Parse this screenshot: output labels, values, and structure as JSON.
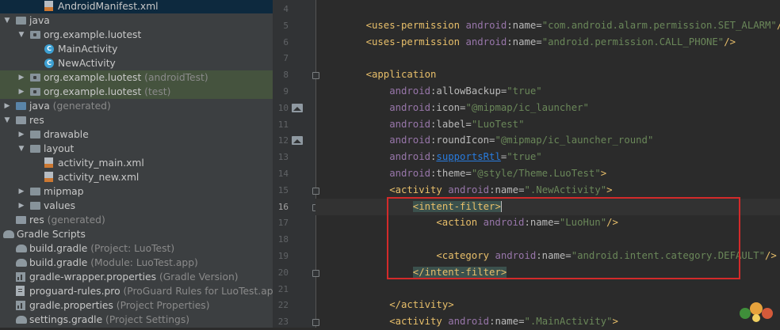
{
  "colors": {
    "tree_bg": "#3c3f41",
    "editor_bg": "#2b2b2b",
    "tag": "#e8bf6a",
    "namespace": "#9876aa",
    "value": "#6a8759",
    "highlight_box": "#d32a2a"
  },
  "tree": [
    {
      "label": "AndroidManifest.xml",
      "hint": "",
      "icon": "xml-file-icon",
      "arrow": "",
      "selected": true
    },
    {
      "label": "java",
      "hint": "",
      "icon": "folder-icon",
      "arrow": "down"
    },
    {
      "label": "org.example.luotest",
      "hint": "",
      "icon": "package-icon",
      "arrow": "down"
    },
    {
      "label": "MainActivity",
      "hint": "",
      "icon": "class-icon",
      "arrow": ""
    },
    {
      "label": "NewActivity",
      "hint": "",
      "icon": "class-icon",
      "arrow": ""
    },
    {
      "label": "org.example.luotest",
      "hint": "(androidTest)",
      "icon": "package-icon",
      "arrow": "right",
      "highlighted": true
    },
    {
      "label": "org.example.luotest",
      "hint": "(test)",
      "icon": "package-icon",
      "arrow": "right",
      "highlighted": true
    },
    {
      "label": "java",
      "hint": "(generated)",
      "icon": "generated-folder-icon",
      "arrow": "right"
    },
    {
      "label": "res",
      "hint": "",
      "icon": "res-folder-icon",
      "arrow": "down"
    },
    {
      "label": "drawable",
      "hint": "",
      "icon": "folder-icon",
      "arrow": "right"
    },
    {
      "label": "layout",
      "hint": "",
      "icon": "folder-icon",
      "arrow": "down"
    },
    {
      "label": "activity_main.xml",
      "hint": "",
      "icon": "layout-xml-icon",
      "arrow": ""
    },
    {
      "label": "activity_new.xml",
      "hint": "",
      "icon": "layout-xml-icon",
      "arrow": ""
    },
    {
      "label": "mipmap",
      "hint": "",
      "icon": "folder-icon",
      "arrow": "right"
    },
    {
      "label": "values",
      "hint": "",
      "icon": "folder-icon",
      "arrow": "right"
    },
    {
      "label": "res",
      "hint": "(generated)",
      "icon": "res-folder-icon",
      "arrow": ""
    },
    {
      "label": "Gradle Scripts",
      "hint": "",
      "icon": "gradle-icon",
      "arrow": "down"
    },
    {
      "label": "build.gradle",
      "hint": "(Project: LuoTest)",
      "icon": "gradle-icon",
      "arrow": ""
    },
    {
      "label": "build.gradle",
      "hint": "(Module: LuoTest.app)",
      "icon": "gradle-icon",
      "arrow": ""
    },
    {
      "label": "gradle-wrapper.properties",
      "hint": "(Gradle Version)",
      "icon": "properties-icon",
      "arrow": ""
    },
    {
      "label": "proguard-rules.pro",
      "hint": "(ProGuard Rules for LuoTest.app)",
      "icon": "pro-file-icon",
      "arrow": ""
    },
    {
      "label": "gradle.properties",
      "hint": "(Project Properties)",
      "icon": "properties-icon",
      "arrow": ""
    },
    {
      "label": "settings.gradle",
      "hint": "(Project Settings)",
      "icon": "gradle-icon",
      "arrow": ""
    }
  ],
  "editor": {
    "current_line": "16",
    "lines": [
      {
        "n": "4",
        "segments": []
      },
      {
        "n": "5",
        "segments": [
          [
            "t",
            "<uses-permission "
          ],
          [
            "ns",
            "android"
          ],
          [
            "a",
            ":name="
          ],
          [
            "v",
            "\"com.android.alarm.permission.SET_ALARM\""
          ],
          [
            "t",
            "/>"
          ]
        ]
      },
      {
        "n": "6",
        "segments": [
          [
            "t",
            "<uses-permission "
          ],
          [
            "ns",
            "android"
          ],
          [
            "a",
            ":name="
          ],
          [
            "v",
            "\"android.permission.CALL_PHONE\""
          ],
          [
            "t",
            "/>"
          ]
        ]
      },
      {
        "n": "7",
        "segments": []
      },
      {
        "n": "8",
        "segments": [
          [
            "t",
            "<application"
          ]
        ]
      },
      {
        "n": "9",
        "segments": [
          [
            "ns",
            "android"
          ],
          [
            "a",
            ":allowBackup="
          ],
          [
            "v",
            "\"true\""
          ]
        ]
      },
      {
        "n": "10",
        "segments": [
          [
            "ns",
            "android"
          ],
          [
            "a",
            ":icon="
          ],
          [
            "v",
            "\"@mipmap/ic_launcher\""
          ]
        ]
      },
      {
        "n": "11",
        "segments": [
          [
            "ns",
            "android"
          ],
          [
            "a",
            ":label="
          ],
          [
            "v",
            "\"LuoTest\""
          ]
        ]
      },
      {
        "n": "12",
        "segments": [
          [
            "ns",
            "android"
          ],
          [
            "a",
            ":roundIcon="
          ],
          [
            "v",
            "\"@mipmap/ic_launcher_round\""
          ]
        ]
      },
      {
        "n": "13",
        "segments": [
          [
            "ns",
            "android"
          ],
          [
            "a",
            ":"
          ],
          [
            "l",
            "supportsRtl"
          ],
          [
            "a",
            "="
          ],
          [
            "v",
            "\"true\""
          ]
        ]
      },
      {
        "n": "14",
        "segments": [
          [
            "ns",
            "android"
          ],
          [
            "a",
            ":theme="
          ],
          [
            "v",
            "\"@style/Theme.LuoTest\""
          ],
          [
            "t",
            ">"
          ]
        ]
      },
      {
        "n": "15",
        "segments": [
          [
            "t",
            "<activity "
          ],
          [
            "ns",
            "android"
          ],
          [
            "a",
            ":name="
          ],
          [
            "v",
            "\".NewActivity\""
          ],
          [
            "t",
            ">"
          ]
        ]
      },
      {
        "n": "16",
        "segments": [
          [
            "tp",
            "<intent-filter>"
          ],
          [
            "caret",
            ""
          ]
        ]
      },
      {
        "n": "17",
        "segments": [
          [
            "t",
            "<action "
          ],
          [
            "ns",
            "android"
          ],
          [
            "a",
            ":name="
          ],
          [
            "v",
            "\"LuoHun\""
          ],
          [
            "t",
            "/>"
          ]
        ]
      },
      {
        "n": "18",
        "segments": []
      },
      {
        "n": "19",
        "segments": [
          [
            "t",
            "<category "
          ],
          [
            "ns",
            "android"
          ],
          [
            "a",
            ":name="
          ],
          [
            "v",
            "\"android.intent.category.DEFAULT\""
          ],
          [
            "t",
            "/>"
          ]
        ]
      },
      {
        "n": "20",
        "segments": [
          [
            "tp",
            "</intent-filter>"
          ]
        ]
      },
      {
        "n": "21",
        "segments": []
      },
      {
        "n": "22",
        "segments": [
          [
            "t",
            "</activity>"
          ]
        ]
      },
      {
        "n": "23",
        "segments": [
          [
            "t",
            "<activity "
          ],
          [
            "ns",
            "android"
          ],
          [
            "a",
            ":name="
          ],
          [
            "v",
            "\".MainActivity\""
          ],
          [
            "t",
            ">"
          ]
        ]
      }
    ]
  }
}
